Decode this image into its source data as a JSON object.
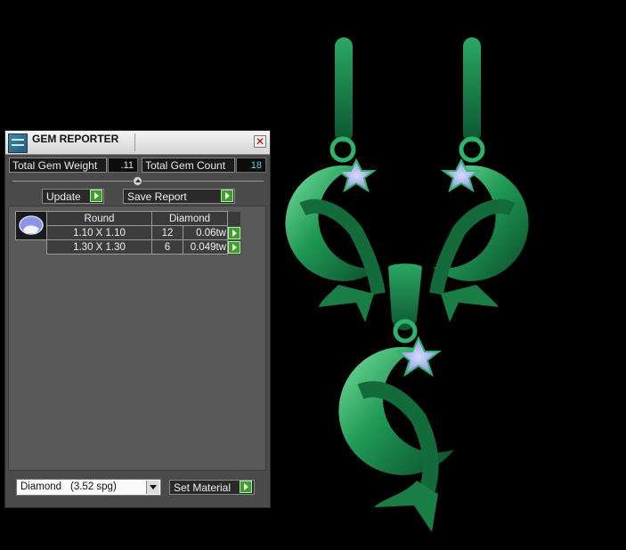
{
  "panel": {
    "title": "GEM REPORTER",
    "close_glyph": "✕",
    "total_weight_label": "Total Gem Weight",
    "total_weight_value": ".11",
    "total_count_label": "Total Gem Count",
    "total_count_value": "18",
    "update_label": "Update",
    "save_report_label": "Save Report",
    "table": {
      "headers": [
        "Round",
        "Diamond"
      ],
      "rows": [
        {
          "size": "1.10 X 1.10",
          "count": "12",
          "weight": "0.06tw"
        },
        {
          "size": "1.30 X 1.30",
          "count": "6",
          "weight": "0.049tw"
        }
      ]
    },
    "material": {
      "name": "Diamond",
      "sg": "(3.52 spg)"
    },
    "set_material_label": "Set Material"
  },
  "colors": {
    "metal_green": "#1f8a4c",
    "gem_blue": "#9aa6f0",
    "go_green": "#3ea02c",
    "count_cyan": "#5fd0e8"
  }
}
